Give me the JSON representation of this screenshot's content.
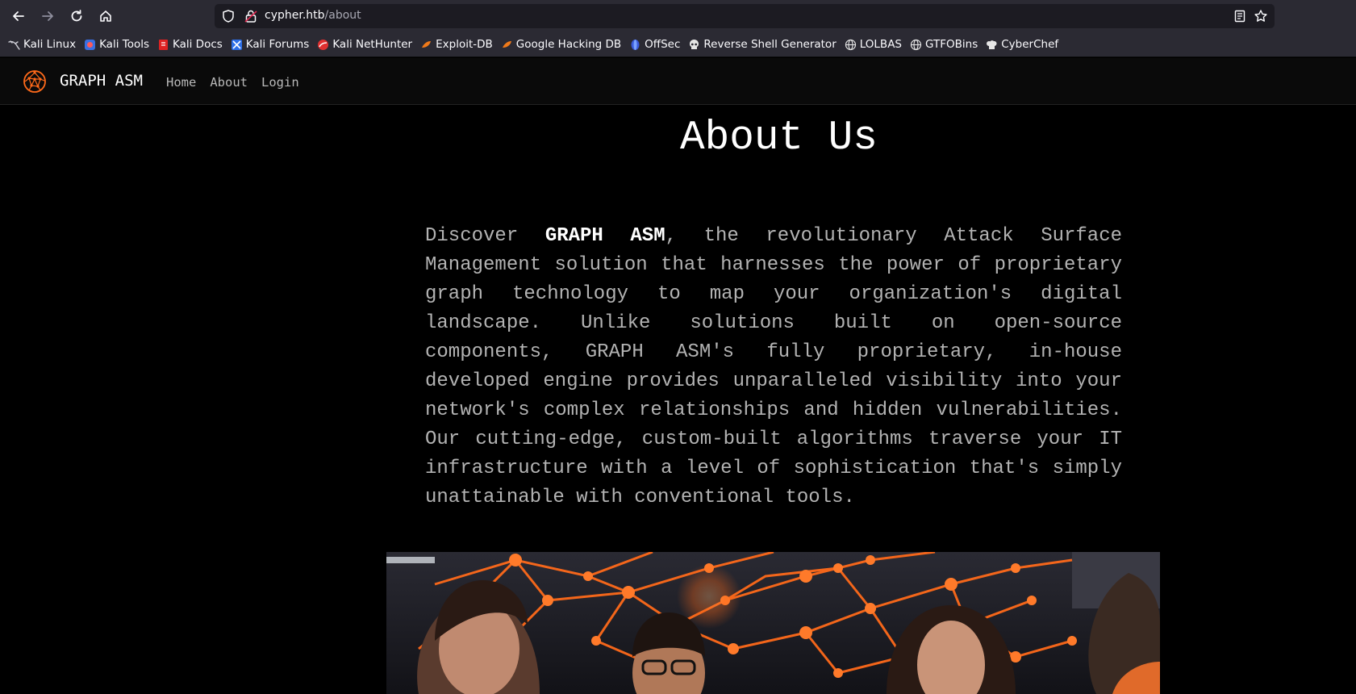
{
  "browser": {
    "url_host": "cypher.htb",
    "url_path": "/about"
  },
  "bookmarks": [
    {
      "label": "Kali Linux",
      "icon": "kali-dragon-icon"
    },
    {
      "label": "Kali Tools",
      "icon": "kali-tools-icon"
    },
    {
      "label": "Kali Docs",
      "icon": "kali-docs-icon"
    },
    {
      "label": "Kali Forums",
      "icon": "kali-forums-icon"
    },
    {
      "label": "Kali NetHunter",
      "icon": "nethunter-icon"
    },
    {
      "label": "Exploit-DB",
      "icon": "exploit-db-icon"
    },
    {
      "label": "Google Hacking DB",
      "icon": "ghdb-icon"
    },
    {
      "label": "OffSec",
      "icon": "offsec-icon"
    },
    {
      "label": "Reverse Shell Generator",
      "icon": "skull-icon"
    },
    {
      "label": "LOLBAS",
      "icon": "globe-icon"
    },
    {
      "label": "GTFOBins",
      "icon": "globe-icon"
    },
    {
      "label": "CyberChef",
      "icon": "chef-hat-icon"
    }
  ],
  "site": {
    "brand": "GRAPH ASM",
    "nav": [
      {
        "label": "Home"
      },
      {
        "label": "About"
      },
      {
        "label": "Login"
      }
    ]
  },
  "page": {
    "title": "About Us",
    "intro_lead": "Discover ",
    "intro_brand": "GRAPH ASM",
    "intro_rest": ", the revolutionary Attack Surface Management solution that harnesses the power of proprietary graph technology to map your organization's digital landscape. Unlike solutions built on open-source components, GRAPH ASM's fully proprietary, in-house developed engine provides unparalleled visibility into your network's complex relationships and hidden vulnerabilities. Our cutting-edge, custom-built algorithms traverse your IT infrastructure with a level of sophistication that's simply unattainable with conventional tools."
  },
  "colors": {
    "accent": "#ff6a1a",
    "background": "#000000",
    "nav_bg": "#0a0a0a",
    "chrome_bg": "#2b2a33"
  }
}
